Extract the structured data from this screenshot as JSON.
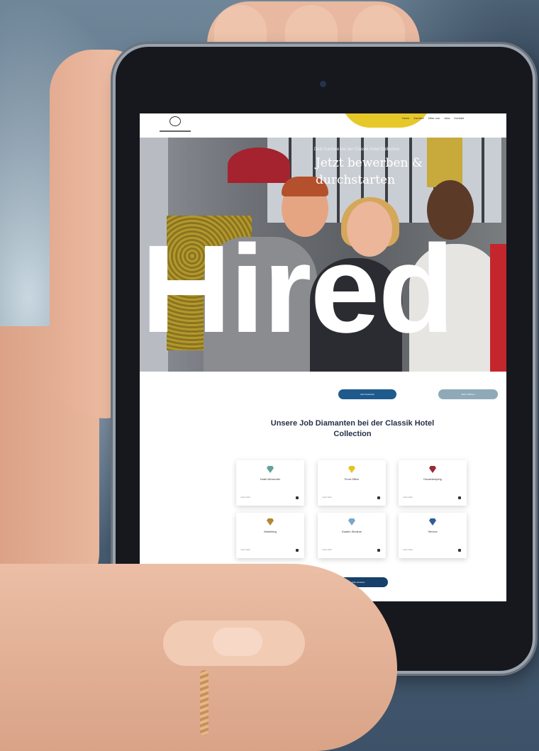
{
  "website": {
    "hero": {
      "kicker": "Dein Karriere bei der Classik Hotel Collection",
      "title": "Jetzt bewerben & durchstarten",
      "wordmark": "Hired"
    },
    "nav": {
      "items": [
        "Home",
        "Karriere",
        "Über uns",
        "Jobs",
        "Kontakt"
      ]
    },
    "buttons": {
      "apply": "Jetzt bewerben",
      "more": "Mehr erfahren",
      "all_jobs": "Alle Jobs ansehen"
    },
    "section_title": "Unsere Job Diamanten bei der Classik Hotel Collection",
    "cards": [
      {
        "title": "Hotel Allrounder",
        "meta": "mehr dazu",
        "gem_color": "#5fa39b"
      },
      {
        "title": "Front Office",
        "meta": "mehr dazu",
        "gem_color": "#e4c51f"
      },
      {
        "title": "Housekeeping",
        "meta": "mehr dazu",
        "gem_color": "#9b2a33"
      },
      {
        "title": "Marketing",
        "meta": "mehr dazu",
        "gem_color": "#b08a32"
      },
      {
        "title": "Duales Studium",
        "meta": "mehr dazu",
        "gem_color": "#7ea6c7"
      },
      {
        "title": "Service",
        "meta": "mehr dazu",
        "gem_color": "#2f5d9a"
      }
    ]
  }
}
